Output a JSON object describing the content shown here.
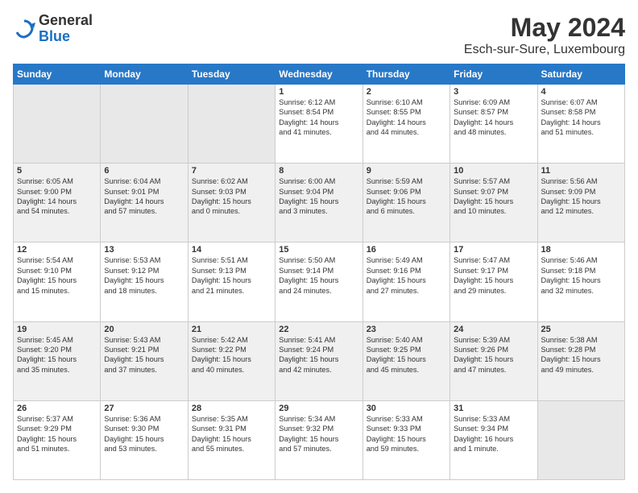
{
  "logo": {
    "general": "General",
    "blue": "Blue"
  },
  "header": {
    "month_year": "May 2024",
    "location": "Esch-sur-Sure, Luxembourg"
  },
  "weekdays": [
    "Sunday",
    "Monday",
    "Tuesday",
    "Wednesday",
    "Thursday",
    "Friday",
    "Saturday"
  ],
  "weeks": [
    [
      {
        "day": "",
        "info": ""
      },
      {
        "day": "",
        "info": ""
      },
      {
        "day": "",
        "info": ""
      },
      {
        "day": "1",
        "info": "Sunrise: 6:12 AM\nSunset: 8:54 PM\nDaylight: 14 hours\nand 41 minutes."
      },
      {
        "day": "2",
        "info": "Sunrise: 6:10 AM\nSunset: 8:55 PM\nDaylight: 14 hours\nand 44 minutes."
      },
      {
        "day": "3",
        "info": "Sunrise: 6:09 AM\nSunset: 8:57 PM\nDaylight: 14 hours\nand 48 minutes."
      },
      {
        "day": "4",
        "info": "Sunrise: 6:07 AM\nSunset: 8:58 PM\nDaylight: 14 hours\nand 51 minutes."
      }
    ],
    [
      {
        "day": "5",
        "info": "Sunrise: 6:05 AM\nSunset: 9:00 PM\nDaylight: 14 hours\nand 54 minutes."
      },
      {
        "day": "6",
        "info": "Sunrise: 6:04 AM\nSunset: 9:01 PM\nDaylight: 14 hours\nand 57 minutes."
      },
      {
        "day": "7",
        "info": "Sunrise: 6:02 AM\nSunset: 9:03 PM\nDaylight: 15 hours\nand 0 minutes."
      },
      {
        "day": "8",
        "info": "Sunrise: 6:00 AM\nSunset: 9:04 PM\nDaylight: 15 hours\nand 3 minutes."
      },
      {
        "day": "9",
        "info": "Sunrise: 5:59 AM\nSunset: 9:06 PM\nDaylight: 15 hours\nand 6 minutes."
      },
      {
        "day": "10",
        "info": "Sunrise: 5:57 AM\nSunset: 9:07 PM\nDaylight: 15 hours\nand 10 minutes."
      },
      {
        "day": "11",
        "info": "Sunrise: 5:56 AM\nSunset: 9:09 PM\nDaylight: 15 hours\nand 12 minutes."
      }
    ],
    [
      {
        "day": "12",
        "info": "Sunrise: 5:54 AM\nSunset: 9:10 PM\nDaylight: 15 hours\nand 15 minutes."
      },
      {
        "day": "13",
        "info": "Sunrise: 5:53 AM\nSunset: 9:12 PM\nDaylight: 15 hours\nand 18 minutes."
      },
      {
        "day": "14",
        "info": "Sunrise: 5:51 AM\nSunset: 9:13 PM\nDaylight: 15 hours\nand 21 minutes."
      },
      {
        "day": "15",
        "info": "Sunrise: 5:50 AM\nSunset: 9:14 PM\nDaylight: 15 hours\nand 24 minutes."
      },
      {
        "day": "16",
        "info": "Sunrise: 5:49 AM\nSunset: 9:16 PM\nDaylight: 15 hours\nand 27 minutes."
      },
      {
        "day": "17",
        "info": "Sunrise: 5:47 AM\nSunset: 9:17 PM\nDaylight: 15 hours\nand 29 minutes."
      },
      {
        "day": "18",
        "info": "Sunrise: 5:46 AM\nSunset: 9:18 PM\nDaylight: 15 hours\nand 32 minutes."
      }
    ],
    [
      {
        "day": "19",
        "info": "Sunrise: 5:45 AM\nSunset: 9:20 PM\nDaylight: 15 hours\nand 35 minutes."
      },
      {
        "day": "20",
        "info": "Sunrise: 5:43 AM\nSunset: 9:21 PM\nDaylight: 15 hours\nand 37 minutes."
      },
      {
        "day": "21",
        "info": "Sunrise: 5:42 AM\nSunset: 9:22 PM\nDaylight: 15 hours\nand 40 minutes."
      },
      {
        "day": "22",
        "info": "Sunrise: 5:41 AM\nSunset: 9:24 PM\nDaylight: 15 hours\nand 42 minutes."
      },
      {
        "day": "23",
        "info": "Sunrise: 5:40 AM\nSunset: 9:25 PM\nDaylight: 15 hours\nand 45 minutes."
      },
      {
        "day": "24",
        "info": "Sunrise: 5:39 AM\nSunset: 9:26 PM\nDaylight: 15 hours\nand 47 minutes."
      },
      {
        "day": "25",
        "info": "Sunrise: 5:38 AM\nSunset: 9:28 PM\nDaylight: 15 hours\nand 49 minutes."
      }
    ],
    [
      {
        "day": "26",
        "info": "Sunrise: 5:37 AM\nSunset: 9:29 PM\nDaylight: 15 hours\nand 51 minutes."
      },
      {
        "day": "27",
        "info": "Sunrise: 5:36 AM\nSunset: 9:30 PM\nDaylight: 15 hours\nand 53 minutes."
      },
      {
        "day": "28",
        "info": "Sunrise: 5:35 AM\nSunset: 9:31 PM\nDaylight: 15 hours\nand 55 minutes."
      },
      {
        "day": "29",
        "info": "Sunrise: 5:34 AM\nSunset: 9:32 PM\nDaylight: 15 hours\nand 57 minutes."
      },
      {
        "day": "30",
        "info": "Sunrise: 5:33 AM\nSunset: 9:33 PM\nDaylight: 15 hours\nand 59 minutes."
      },
      {
        "day": "31",
        "info": "Sunrise: 5:33 AM\nSunset: 9:34 PM\nDaylight: 16 hours\nand 1 minute."
      },
      {
        "day": "",
        "info": ""
      }
    ]
  ]
}
